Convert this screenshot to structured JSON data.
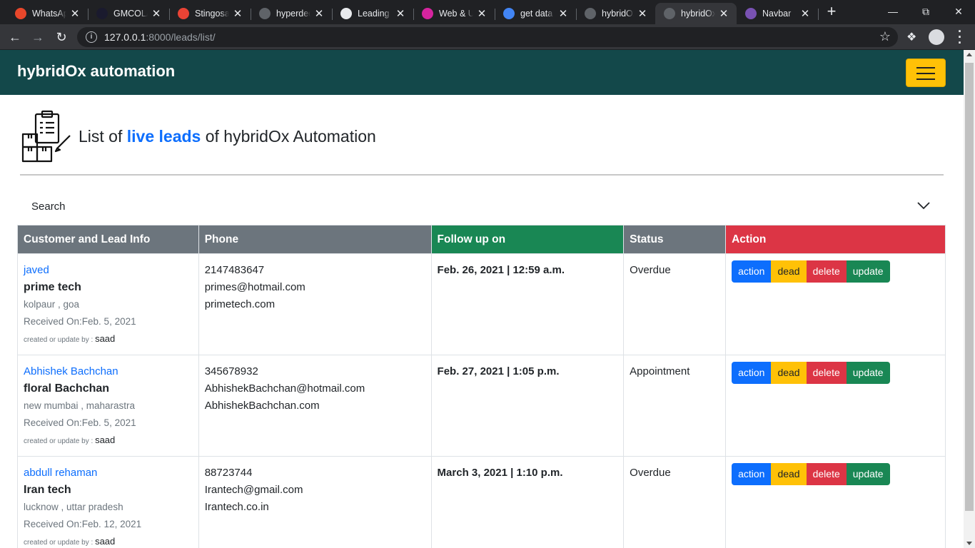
{
  "browser": {
    "tabs": [
      {
        "title": "WhatsApp",
        "favicon": "alert-icon",
        "color": "#e8472b"
      },
      {
        "title": "GMCOLAB",
        "favicon": "dots-icon",
        "color": "#1a1a2e"
      },
      {
        "title": "Stingosal",
        "favicon": "gmail-icon",
        "color": "#ea4335"
      },
      {
        "title": "hyperdec",
        "favicon": "globe-icon",
        "color": "#5f6368"
      },
      {
        "title": "Leading",
        "favicon": "globe-icon",
        "color": "#e8eaed"
      },
      {
        "title": "Web & U",
        "favicon": "instagram-icon",
        "color": "#d6249f"
      },
      {
        "title": "get data",
        "favicon": "google-icon",
        "color": "#4285f4"
      },
      {
        "title": "hybridOx",
        "favicon": "globe-icon",
        "color": "#5f6368"
      },
      {
        "title": "hybridOx",
        "favicon": "globe-icon",
        "color": "#5f6368"
      },
      {
        "title": "Navbar",
        "favicon": "bootstrap-icon",
        "color": "#7952b3"
      }
    ],
    "active_tab_index": 8,
    "url_host": "127.0.0.1",
    "url_path": ":8000/leads/list/"
  },
  "navbar": {
    "brand": "hybridOx automation",
    "toggler_color": "#ffc107",
    "background": "#13484a"
  },
  "header": {
    "prefix": "List of ",
    "accent": "live leads",
    "suffix": " of hybridOx Automation"
  },
  "search": {
    "label": "Search"
  },
  "table": {
    "columns": [
      {
        "label": "Customer and Lead Info",
        "color": "#6c757d"
      },
      {
        "label": "Phone",
        "color": "#6c757d"
      },
      {
        "label": "Follow up on",
        "color": "#198754"
      },
      {
        "label": "Status",
        "color": "#6c757d"
      },
      {
        "label": "Action",
        "color": "#dc3545"
      }
    ],
    "rows": [
      {
        "name": "javed",
        "company": "prime tech",
        "location": "kolpaur , goa",
        "received": "Received On:Feb. 5, 2021",
        "by_label": "created or update by : ",
        "by_user": "saad",
        "phone": "2147483647",
        "email": "primes@hotmail.com",
        "website": "primetech.com",
        "follow_up": "Feb. 26, 2021 | 12:59 a.m.",
        "status": "Overdue"
      },
      {
        "name": "Abhishek Bachchan",
        "company": "floral Bachchan",
        "location": "new mumbai , maharastra",
        "received": "Received On:Feb. 5, 2021",
        "by_label": "created or update by : ",
        "by_user": "saad",
        "phone": "345678932",
        "email": "AbhishekBachchan@hotmail.com",
        "website": "AbhishekBachchan.com",
        "follow_up": "Feb. 27, 2021 | 1:05 p.m.",
        "status": "Appointment"
      },
      {
        "name": "abdull rehaman",
        "company": "Iran tech",
        "location": "lucknow , uttar pradesh",
        "received": "Received On:Feb. 12, 2021",
        "by_label": "created or update by : ",
        "by_user": "saad",
        "phone": "88723744",
        "email": "Irantech@gmail.com",
        "website": "Irantech.co.in",
        "follow_up": "March 3, 2021 | 1:10 p.m.",
        "status": "Overdue"
      }
    ],
    "actions": {
      "action": "action",
      "dead": "dead",
      "delete": "delete",
      "update": "update"
    }
  }
}
